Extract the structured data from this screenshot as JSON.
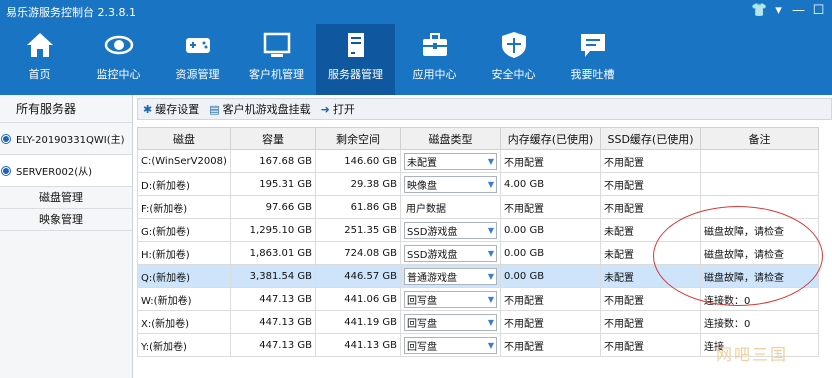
{
  "app": {
    "title": "易乐游服务控制台 2.3.8.1"
  },
  "window_controls": [
    "tshirt-icon",
    "dropdown-icon",
    "minimize-icon",
    "maximize-icon"
  ],
  "nav": [
    {
      "label": "首页",
      "icon": "home-icon"
    },
    {
      "label": "监控中心",
      "icon": "eye-icon"
    },
    {
      "label": "资源管理",
      "icon": "gamepad-icon"
    },
    {
      "label": "客户机管理",
      "icon": "monitor-icon"
    },
    {
      "label": "服务器管理",
      "icon": "server-icon",
      "active": true
    },
    {
      "label": "应用中心",
      "icon": "toolbox-icon"
    },
    {
      "label": "安全中心",
      "icon": "shield-icon"
    },
    {
      "label": "我要吐槽",
      "icon": "chat-icon"
    }
  ],
  "sidebar": {
    "header": "所有服务器",
    "servers": [
      "ELY-20190331QWI(主)",
      "SERVER002(从)"
    ],
    "sub_items": [
      "磁盘管理",
      "映象管理"
    ]
  },
  "toolbar": {
    "cache": "缓存设置",
    "mount": "客户机游戏盘挂载",
    "open": "打开"
  },
  "table": {
    "columns": [
      "磁盘",
      "容量",
      "剩余空间",
      "磁盘类型",
      "内存缓存(已使用)",
      "SSD缓存(已使用)",
      "备注"
    ],
    "rows": [
      {
        "disk": "C:(WinSerV2008)",
        "capacity": "167.68 GB",
        "free": "146.60 GB",
        "type": "未配置",
        "mem": "不用配置",
        "ssd": "不用配置",
        "note": ""
      },
      {
        "disk": "D:(新加卷)",
        "capacity": "195.31 GB",
        "free": "29.38 GB",
        "type": "映像盘",
        "mem": "4.00 GB",
        "ssd": "不用配置",
        "note": ""
      },
      {
        "disk": "F:(新加卷)",
        "capacity": "97.66 GB",
        "free": "61.86 GB",
        "type": "用户数据",
        "mem": "不用配置",
        "ssd": "不用配置",
        "note": ""
      },
      {
        "disk": "G:(新加卷)",
        "capacity": "1,295.10 GB",
        "free": "251.35 GB",
        "type": "SSD游戏盘",
        "mem": "0.00 GB",
        "ssd": "未配置",
        "note": "磁盘故障，请检查"
      },
      {
        "disk": "H:(新加卷)",
        "capacity": "1,863.01 GB",
        "free": "724.08 GB",
        "type": "SSD游戏盘",
        "mem": "0.00 GB",
        "ssd": "未配置",
        "note": "磁盘故障，请检查"
      },
      {
        "disk": "Q:(新加卷)",
        "capacity": "3,381.54 GB",
        "free": "446.57 GB",
        "type": "普通游戏盘",
        "mem": "0.00 GB",
        "ssd": "未配置",
        "note": "磁盘故障，请检查",
        "selected": true
      },
      {
        "disk": "W:(新加卷)",
        "capacity": "447.13 GB",
        "free": "441.06 GB",
        "type": "回写盘",
        "mem": "不用配置",
        "ssd": "不用配置",
        "note": "连接数：0"
      },
      {
        "disk": "X:(新加卷)",
        "capacity": "447.13 GB",
        "free": "441.19 GB",
        "type": "回写盘",
        "mem": "不用配置",
        "ssd": "不用配置",
        "note": "连接数：0"
      },
      {
        "disk": "Y:(新加卷)",
        "capacity": "447.13 GB",
        "free": "441.13 GB",
        "type": "回写盘",
        "mem": "不用配置",
        "ssd": "不用配置",
        "note": "连接"
      }
    ]
  },
  "watermark": "网吧三国",
  "colors": {
    "header_bg": "#1a74c4",
    "nav_active": "#0f58a0",
    "row_selected": "#cde4fb",
    "annotation": "#d43a3a"
  }
}
